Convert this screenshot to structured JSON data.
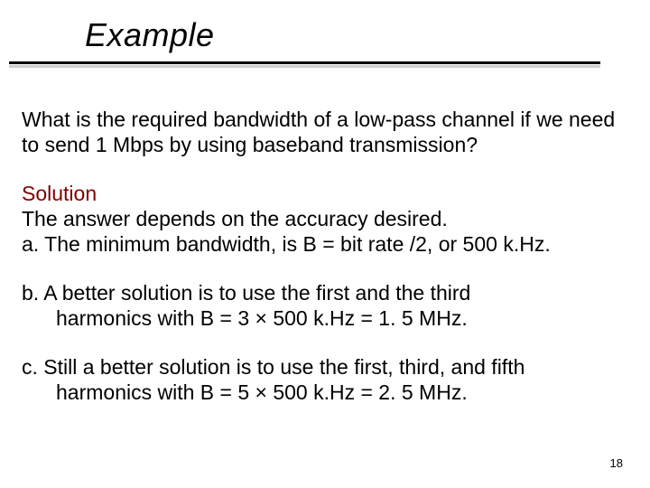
{
  "title": "Example",
  "question": "What is the required bandwidth of a low-pass channel if we need to send 1 Mbps by using baseband transmission?",
  "solution_label": "Solution",
  "solution_intro": "The answer depends on the accuracy desired.",
  "item_a": "a. The minimum bandwidth, is B = bit rate /2, or 500 k.Hz.",
  "item_b_line1": "b. A better solution is to use the first and the third",
  "item_b_line2": "harmonics with  B = 3 × 500 k.Hz = 1. 5 MHz.",
  "item_c_line1": "c. Still a better solution is to use the first, third, and fifth",
  "item_c_line2": "harmonics with B = 5 × 500 k.Hz = 2. 5 MHz.",
  "page_number": "18"
}
